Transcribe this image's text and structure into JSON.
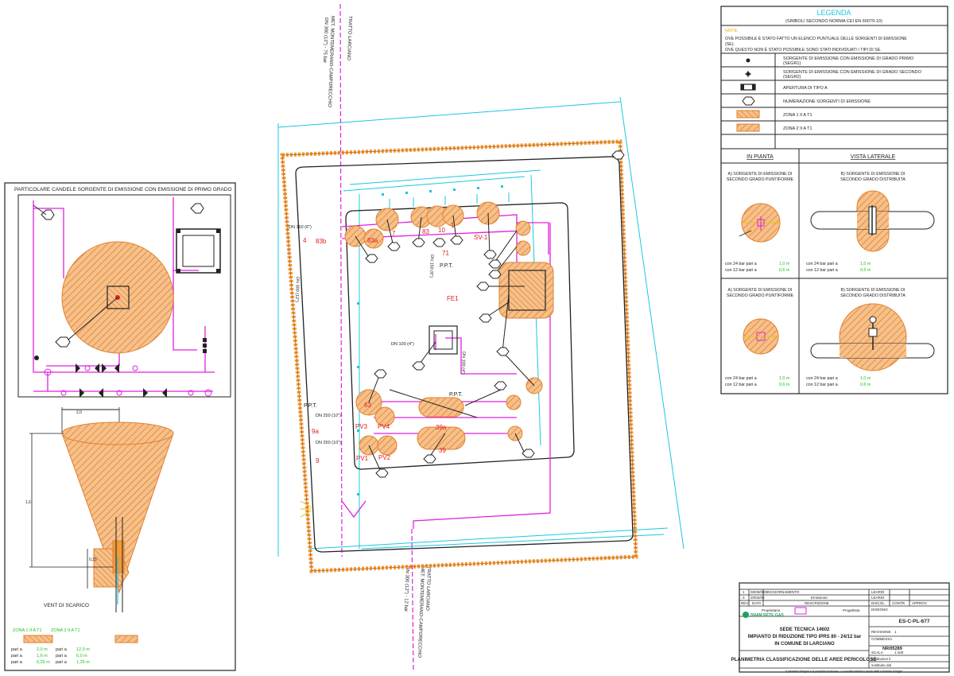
{
  "colors": {
    "magenta": "#e020e0",
    "cyan": "#18c8e0",
    "orange": "#f09a3a",
    "orange_fill": "#f6c08a",
    "red": "#e02020",
    "green": "#20c020",
    "dark": "#202020"
  },
  "legend": {
    "title": "LEGENDA",
    "subtitle": "(SIMBOLI SECONDO NORMA CEI EN 60079-10)",
    "note_label": "NOTE:",
    "note_lines": [
      "OVE POSSIBILE   È STATO FATTO UN ELENCO PUNTUALE DELLE SORGENTI DI EMISSIONE",
      "(SE).",
      "OVE QUESTO NON  È STATO POSSIBILE SONO STATI INDIVIDUATI I TIPI DI SE."
    ],
    "rows": [
      {
        "symbol": "dot",
        "line1": "SORGENTE DI EMISSIONE CON EMISSIONE DI GRADO PRIMO",
        "line2": "(SEGR1)"
      },
      {
        "symbol": "cross-dot",
        "line1": "SORGENTE DI EMISSIONE CON EMISSIONE DI GRADO SECONDO",
        "line2": "(SEGR2)"
      },
      {
        "symbol": "opening",
        "line1": "APERTURA DI TIPO A",
        "line2": ""
      },
      {
        "symbol": "hexagon",
        "line1": "NUMERAZIONE SORGENTI DI EMISSIONE",
        "line2": ""
      },
      {
        "symbol": "zone1",
        "line1": "ZONA 1 II A T1",
        "line2": ""
      },
      {
        "symbol": "zone2",
        "line1": "ZONA 2 II A T1",
        "line2": ""
      }
    ],
    "in_pianta": "IN PIANTA",
    "vista_laterale": "VISTA LATERALE",
    "detail_a_title": [
      "A) SORGENTE DI EMISSIONE DI",
      "SECONDO GRADO PUNTIFORME"
    ],
    "detail_b_title": [
      "B) SORGENTE DI EMISSIONE DI",
      "SECONDO GRADO DISTRIBUITA"
    ],
    "dist_line1": "con 24 bar pari a",
    "dist_val1": "1,0 m",
    "dist_line2": "con 12 bar pari a",
    "dist_val2": "0,6 m"
  },
  "detail_left": {
    "title": "PARTICOLARE CANDELE SORGENTE DI EMISSIONE CON EMISSIONE DI PRIMO GRADO",
    "vent_label": "VENT DI SCARICO",
    "zone1_label": "ZONA 1 II A T1",
    "zone2_label": "ZONA 2 II A T1",
    "dim_rows": [
      {
        "a": "pari a",
        "b": "2,0 m",
        "c": "pari a",
        "d": "12,0 m"
      },
      {
        "a": "pari a",
        "b": "1,6 m",
        "c": "pari a",
        "d": "6,0 m"
      },
      {
        "a": "pari a",
        "b": "0,25 m",
        "c": "pari a",
        "d": "1,25 m"
      }
    ]
  },
  "plan": {
    "labels_red": [
      "83b",
      "83a",
      "7",
      "83",
      "1",
      "10",
      "71",
      "SV-1",
      "FE1",
      "9a",
      "PV3",
      "PV4",
      "PV1",
      "PV2",
      "39",
      "39a",
      "9",
      "4",
      "63"
    ],
    "labels_dark": [
      "P.P.T.",
      "P.P.T.",
      "P.P.T.",
      "DN 100 (4\")",
      "DN 150 (6\")",
      "DN 250 (10\")",
      "DN 250 (10\")",
      "DN 150 (6\")",
      "DN 100 (4\")",
      "DN 300 (12\")"
    ],
    "pipe_top_text": [
      "MET. MONTEMERANO-CAMPORECCHIO",
      "DN 300 (12\") - 75 bar",
      "TRATTO LARCIANO"
    ],
    "pipe_bottom_text": [
      "MET. MONTEMERANO-CAMPORECCHIO",
      "TRATTO LARCIANO",
      "DN 300 (12\") - 12 bar"
    ],
    "vertical_dim_label": "DN 300 (12\")"
  },
  "title_block": {
    "rev_rows": [
      {
        "rev": "1",
        "data": "00/00/0000",
        "descr": "AGGIORNAMENTO",
        "a": "",
        "b": ""
      },
      {
        "rev": "0",
        "data": "20/02/08",
        "descr": "Emissione",
        "a": "LEARDI",
        "b": ""
      }
    ],
    "header_rev": "REV.",
    "header_data": "DATA",
    "header_descr": "DESCRIZIONE",
    "header_discol": "DISCOL.",
    "header_contr": "CONTR.",
    "header_approv": "APPROV.",
    "leardi": "LEARDI",
    "proprietario_label": "Proprietario",
    "company": "SNAM RETE GAS",
    "progettista_label": "Progettista",
    "disegno_label": "DISEGNO",
    "disegno_value": "ES-C-PL-677",
    "rev_label": "REVISIONE",
    "rev_value": "1",
    "line1": "SEDE TECNICA 14602",
    "line2": "IMPIANTO DI RIDUZIONE TIPO IPRS 80 - 24/12 bar",
    "line3": "IN COMUNE DI LARCIANO",
    "commessa_label": "COMMESSA",
    "commessa_value": "NR/05289",
    "scala_label": "SCALA",
    "scala_value": "1:100",
    "sost_label": "sostituisce il",
    "sost2_label": "sostituito dal",
    "main_title": "PLANIMETRIA CLASSIFICAZIONE DELLE AREE PERICOLOSE",
    "footer": "Il presente disegno è di proprietà esclusiva - La società tutelerà i propri diritti a termine di legge."
  }
}
